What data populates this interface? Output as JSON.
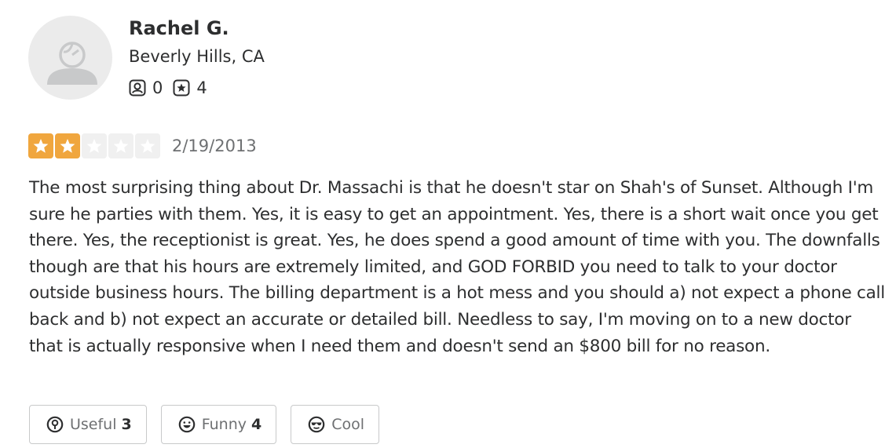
{
  "user": {
    "name": "Rachel G.",
    "location": "Beverly Hills, CA",
    "friends_icon": "friends-icon",
    "friends_count": "0",
    "reviews_icon": "reviews-star-icon",
    "reviews_count": "4",
    "avatar_icon": "default-user-avatar-icon"
  },
  "review": {
    "rating": 2,
    "max_rating": 5,
    "star_color": "#f0a63e",
    "empty_star_color": "#f0f0f0",
    "date": "2/19/2013",
    "text": "The most surprising thing about Dr. Massachi is that he doesn't star on Shah's of Sunset. Although I'm sure he parties with them. Yes, it is easy to get an appointment. Yes, there is a short wait once you get there. Yes, the receptionist is great. Yes, he does spend a good amount of time with you. The downfalls though are that his hours are extremely limited, and GOD FORBID you need to talk to your doctor outside business hours. The billing department is a hot mess and you should a) not expect a phone call back and b) not expect an accurate or detailed bill. Needless to say, I'm moving on to a new doctor that is actually responsive when I need them and doesn't send an $800 bill for no reason."
  },
  "reactions": {
    "useful": {
      "label": "Useful",
      "count": "3",
      "icon": "lightbulb-icon"
    },
    "funny": {
      "label": "Funny",
      "count": "4",
      "icon": "smile-icon"
    },
    "cool": {
      "label": "Cool",
      "count": "",
      "icon": "sunglasses-icon"
    }
  }
}
